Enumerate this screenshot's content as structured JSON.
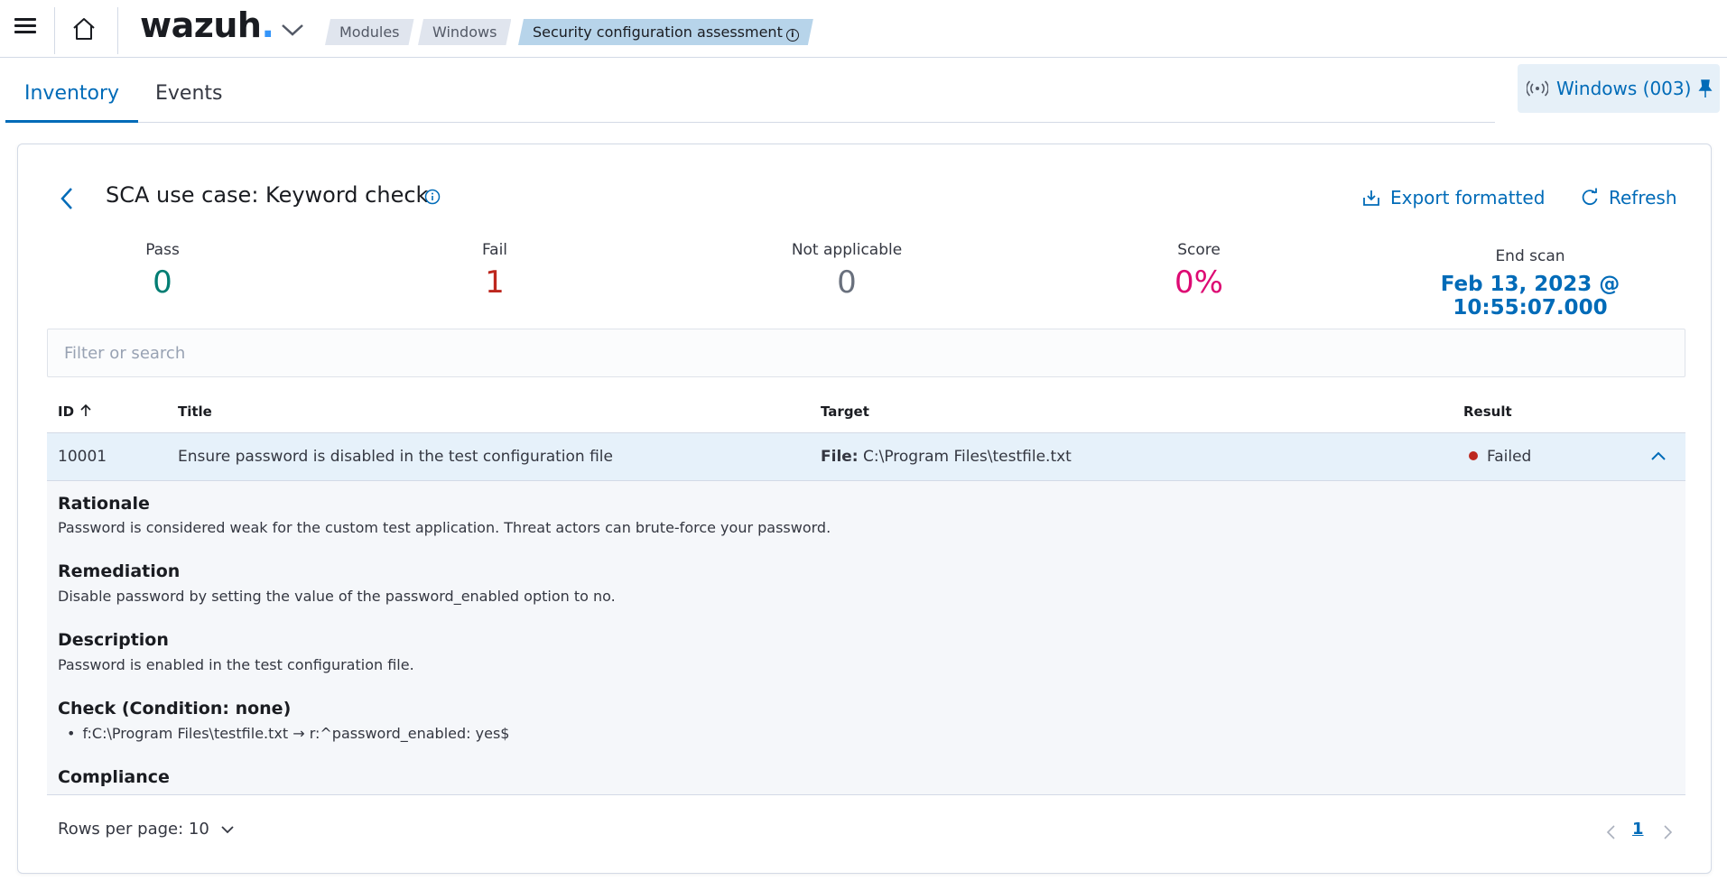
{
  "header": {
    "logo": "wazuh",
    "logo_dot": ".",
    "breadcrumbs": [
      "Modules",
      "Windows",
      "Security configuration assessment"
    ],
    "breadcrumb_info": "i"
  },
  "tabs": [
    {
      "label": "Inventory",
      "active": true
    },
    {
      "label": "Events",
      "active": false
    }
  ],
  "agent": {
    "label": "Windows (003)"
  },
  "panel": {
    "title": "SCA use case: Keyword check",
    "export_label": "Export formatted",
    "refresh_label": "Refresh"
  },
  "stats": {
    "pass_label": "Pass",
    "pass_value": "0",
    "fail_label": "Fail",
    "fail_value": "1",
    "na_label": "Not applicable",
    "na_value": "0",
    "score_label": "Score",
    "score_value": "0%",
    "end_label": "End scan",
    "end_value": "Feb 13, 2023 @ 10:55:07.000"
  },
  "search": {
    "placeholder": "Filter or search"
  },
  "table": {
    "columns": [
      "ID",
      "Title",
      "Target",
      "Result"
    ],
    "rows": [
      {
        "id": "10001",
        "title": "Ensure password is disabled in the test configuration file",
        "target_label": "File:",
        "target_value": "C:\\Program Files\\testfile.txt",
        "result": "Failed"
      }
    ]
  },
  "details": {
    "rationale_h": "Rationale",
    "rationale": "Password is considered weak for the custom test application. Threat actors can brute-force your password.",
    "remediation_h": "Remediation",
    "remediation": "Disable password by setting the value of the password_enabled option to no.",
    "description_h": "Description",
    "description": "Password is enabled in the test configuration file.",
    "check_h": "Check (Condition: none)",
    "check_item": "f:C:\\Program Files\\testfile.txt → r:^password_enabled: yes$",
    "compliance_h": "Compliance"
  },
  "pagination": {
    "rows_per_page": "Rows per page: 10",
    "current_page": "1"
  },
  "colors": {
    "accent": "#006bb8",
    "pass": "#017d73",
    "fail": "#bd271e",
    "na": "#69707d",
    "score": "#dd0a73"
  }
}
